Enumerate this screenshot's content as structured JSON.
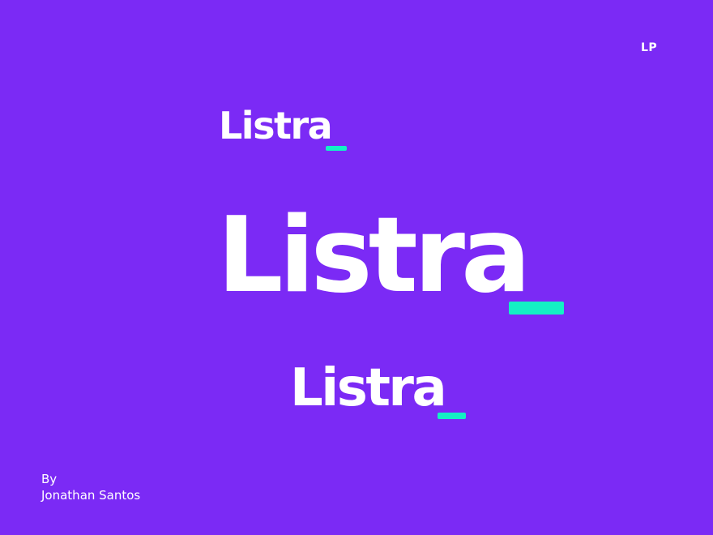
{
  "corner_mark": "LP",
  "logo": {
    "wordmark": "Listra",
    "text_color": "#ffffff",
    "cursor_color": "#13f0c4"
  },
  "background_color": "#7b2af5",
  "credit": {
    "by": "By",
    "author": "Jonathan Santos"
  }
}
